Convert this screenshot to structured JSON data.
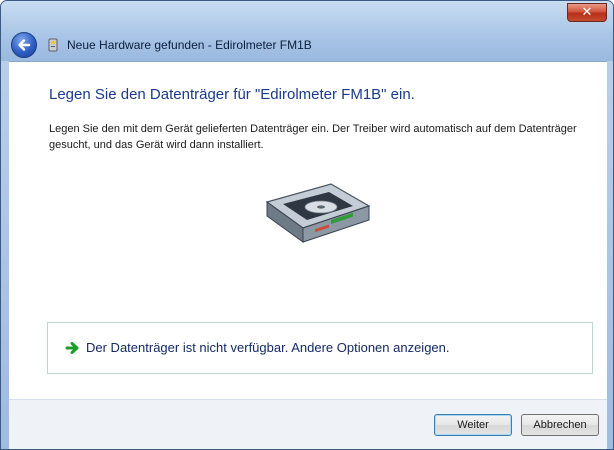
{
  "window": {
    "title": "Neue Hardware gefunden - Edirolmeter FM1B",
    "close_glyph": "✕"
  },
  "main": {
    "heading": "Legen Sie den Datenträger für \"Edirolmeter FM1B\" ein.",
    "description": "Legen Sie den mit dem Gerät gelieferten Datenträger ein. Der Treiber wird automatisch auf dem Datenträger gesucht, und das Gerät wird dann installiert.",
    "option_text": "Der Datenträger ist nicht verfügbar. Andere Optionen anzeigen."
  },
  "footer": {
    "next_label": "Weiter",
    "cancel_label": "Abbrechen"
  },
  "icons": {
    "back": "back-arrow-icon",
    "hardware": "hardware-device-icon",
    "drive": "disc-drive-icon",
    "option": "green-arrow-icon"
  },
  "colors": {
    "heading": "#1a3a8c",
    "accent_green": "#1c9d2a",
    "close": "#c74a2f"
  }
}
